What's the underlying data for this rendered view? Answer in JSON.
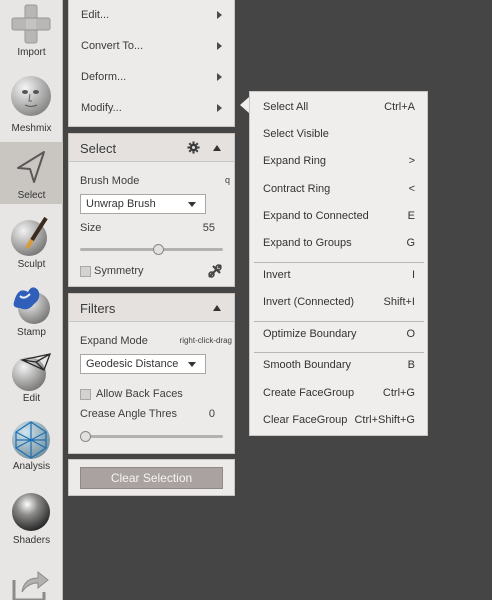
{
  "toolbar": {
    "items": [
      {
        "label": "Import",
        "icon": "plus-icon"
      },
      {
        "label": "Meshmix",
        "icon": "meshmix-head-icon"
      },
      {
        "label": "Select",
        "icon": "select-arrow-icon",
        "selected": true
      },
      {
        "label": "Sculpt",
        "icon": "sculpt-brush-icon"
      },
      {
        "label": "Stamp",
        "icon": "stamp-icon"
      },
      {
        "label": "Edit",
        "icon": "edit-sphere-icon"
      },
      {
        "label": "Analysis",
        "icon": "analysis-mesh-icon"
      },
      {
        "label": "Shaders",
        "icon": "shader-sphere-icon"
      },
      {
        "label": "",
        "icon": "export-icon"
      }
    ]
  },
  "actions_menu": {
    "items": [
      {
        "label": "Edit..."
      },
      {
        "label": "Convert To..."
      },
      {
        "label": "Deform..."
      },
      {
        "label": "Modify..."
      }
    ]
  },
  "select_panel": {
    "title": "Select",
    "brush_mode_label": "Brush Mode",
    "brush_mode_hint": "q",
    "brush_mode_value": "Unwrap Brush",
    "size_label": "Size",
    "size_value": "55",
    "size_fraction": 0.55,
    "symmetry_label": "Symmetry",
    "symmetry_checked": false
  },
  "filters_panel": {
    "title": "Filters",
    "expand_mode_label": "Expand Mode",
    "expand_mode_hint": "right-click-drag",
    "expand_mode_value": "Geodesic Distance",
    "allow_back_faces_label": "Allow Back Faces",
    "allow_back_faces_checked": false,
    "crease_label": "Crease Angle Thres",
    "crease_value": "0",
    "crease_fraction": 0
  },
  "clear_selection_label": "Clear Selection",
  "context_menu": {
    "groups": [
      [
        {
          "label": "Select All",
          "shortcut": "Ctrl+A"
        },
        {
          "label": "Select Visible",
          "shortcut": ""
        },
        {
          "label": "Expand Ring",
          "shortcut": ">"
        },
        {
          "label": "Contract Ring",
          "shortcut": "<"
        },
        {
          "label": "Expand to Connected",
          "shortcut": "E"
        },
        {
          "label": "Expand to Groups",
          "shortcut": "G"
        }
      ],
      [
        {
          "label": "Invert",
          "shortcut": "I"
        },
        {
          "label": "Invert (Connected)",
          "shortcut": "Shift+I"
        }
      ],
      [
        {
          "label": "Optimize Boundary",
          "shortcut": "O"
        }
      ],
      [
        {
          "label": "Smooth Boundary",
          "shortcut": "B"
        },
        {
          "label": "Create FaceGroup",
          "shortcut": "Ctrl+G"
        },
        {
          "label": "Clear FaceGroup",
          "shortcut": "Ctrl+Shift+G"
        }
      ]
    ]
  },
  "colors": {
    "viewport_bg": "#454545",
    "panel_bg": "#edebe9",
    "button_bg": "#a9a2a0"
  }
}
